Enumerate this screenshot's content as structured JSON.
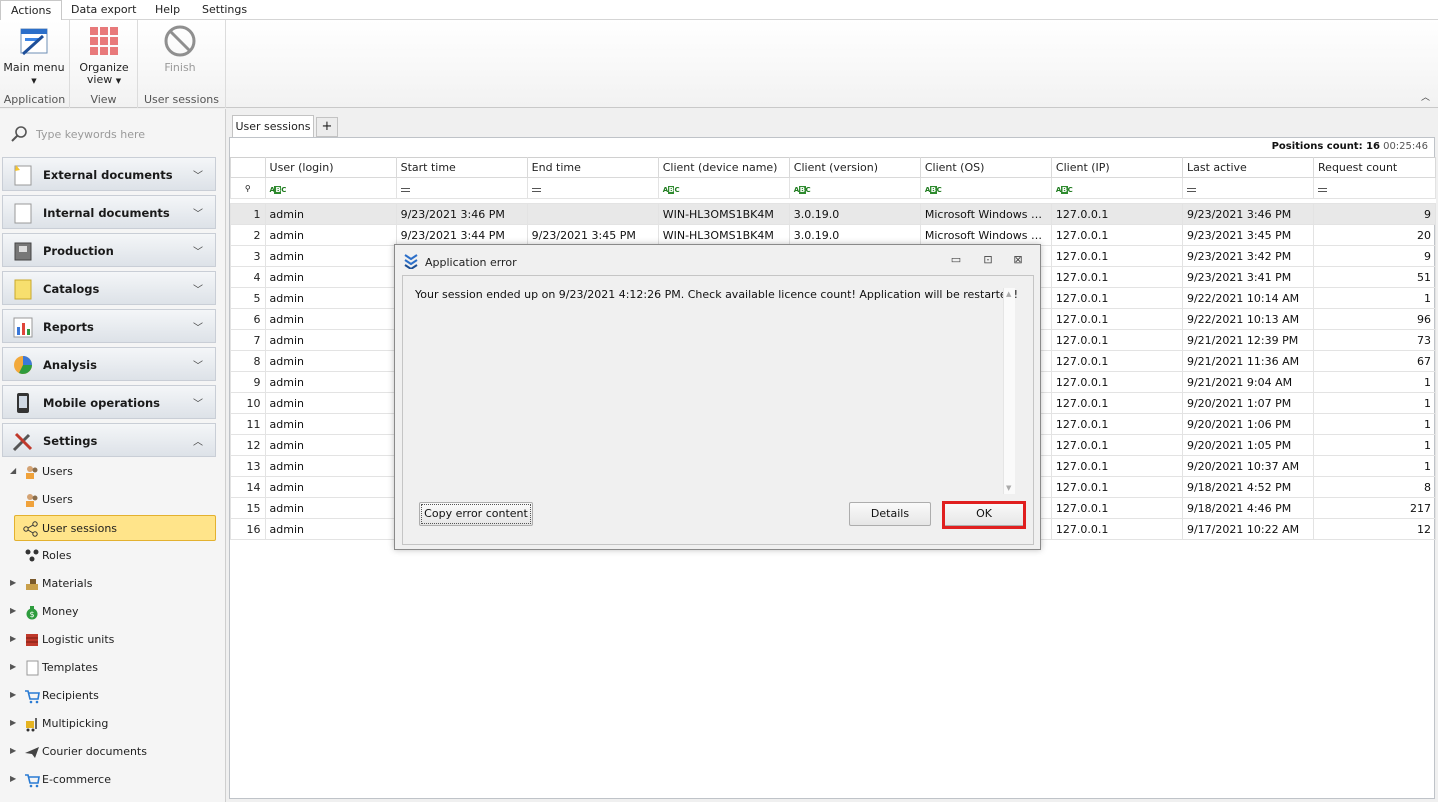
{
  "menu_tabs": [
    "Actions",
    "Data export",
    "Help",
    "Settings"
  ],
  "ribbon": {
    "groups": [
      {
        "label": "Application",
        "buttons": [
          {
            "label_line1": "Main menu",
            "label_line2": "",
            "icon": "main-menu-icon",
            "dropdown": true
          }
        ]
      },
      {
        "label": "View",
        "buttons": [
          {
            "label_line1": "Organize",
            "label_line2": "view",
            "icon": "grid-icon",
            "dropdown": true
          }
        ]
      },
      {
        "label": "User sessions",
        "buttons": [
          {
            "label_line1": "Finish",
            "label_line2": "",
            "icon": "finish-icon",
            "disabled": true
          }
        ]
      }
    ]
  },
  "sidebar": {
    "search_placeholder": "Type keywords here",
    "categories": [
      {
        "label": "External documents",
        "icon": "external-documents-icon",
        "expanded": false
      },
      {
        "label": "Internal documents",
        "icon": "internal-documents-icon",
        "expanded": false
      },
      {
        "label": "Production",
        "icon": "production-icon",
        "expanded": false
      },
      {
        "label": "Catalogs",
        "icon": "catalogs-icon",
        "expanded": false
      },
      {
        "label": "Reports",
        "icon": "reports-icon",
        "expanded": false
      },
      {
        "label": "Analysis",
        "icon": "analysis-icon",
        "expanded": false
      },
      {
        "label": "Mobile operations",
        "icon": "mobile-icon",
        "expanded": false
      },
      {
        "label": "Settings",
        "icon": "settings-icon",
        "expanded": true
      }
    ],
    "tree": [
      {
        "label": "Users",
        "level": 0,
        "arrow": "down"
      },
      {
        "label": "Users",
        "level": 1
      },
      {
        "label": "User sessions",
        "level": 1,
        "selected": true
      },
      {
        "label": "Roles",
        "level": 1
      },
      {
        "label": "Materials",
        "level": 0,
        "arrow": "right"
      },
      {
        "label": "Money",
        "level": 0,
        "arrow": "right"
      },
      {
        "label": "Logistic units",
        "level": 0,
        "arrow": "right"
      },
      {
        "label": "Templates",
        "level": 0,
        "arrow": "right"
      },
      {
        "label": "Recipients",
        "level": 0,
        "arrow": "right"
      },
      {
        "label": "Multipicking",
        "level": 0,
        "arrow": "right"
      },
      {
        "label": "Courier documents",
        "level": 0,
        "arrow": "right"
      },
      {
        "label": "E-commerce",
        "level": 0,
        "arrow": "right"
      }
    ]
  },
  "main": {
    "tab_label": "User sessions",
    "tab_add": "+",
    "positions_label": "Positions count:",
    "positions_value": "16",
    "timer": "00:25:46",
    "columns": [
      "User (login)",
      "Start time",
      "End time",
      "Client (device name)",
      "Client (version)",
      "Client (OS)",
      "Client (IP)",
      "Last active",
      "Request count"
    ],
    "rows": [
      [
        "1",
        "admin",
        "9/23/2021 3:46 PM",
        "",
        "WIN-HL3OMS1BK4M",
        "3.0.19.0",
        "Microsoft Windows NT ...",
        "127.0.0.1",
        "9/23/2021 3:46 PM",
        "9"
      ],
      [
        "2",
        "admin",
        "9/23/2021 3:44 PM",
        "9/23/2021 3:45 PM",
        "WIN-HL3OMS1BK4M",
        "3.0.19.0",
        "Microsoft Windows NT ...",
        "127.0.0.1",
        "9/23/2021 3:45 PM",
        "20"
      ],
      [
        "3",
        "admin",
        "",
        "",
        "",
        "",
        "",
        "127.0.0.1",
        "9/23/2021 3:42 PM",
        "9"
      ],
      [
        "4",
        "admin",
        "",
        "",
        "",
        "",
        "",
        "127.0.0.1",
        "9/23/2021 3:41 PM",
        "51"
      ],
      [
        "5",
        "admin",
        "",
        "",
        "",
        "",
        "",
        "127.0.0.1",
        "9/22/2021 10:14 AM",
        "1"
      ],
      [
        "6",
        "admin",
        "",
        "",
        "",
        "",
        "",
        "127.0.0.1",
        "9/22/2021 10:13 AM",
        "96"
      ],
      [
        "7",
        "admin",
        "",
        "",
        "",
        "",
        "",
        "127.0.0.1",
        "9/21/2021 12:39 PM",
        "73"
      ],
      [
        "8",
        "admin",
        "",
        "",
        "",
        "",
        "",
        "127.0.0.1",
        "9/21/2021 11:36 AM",
        "67"
      ],
      [
        "9",
        "admin",
        "",
        "",
        "",
        "",
        "",
        "127.0.0.1",
        "9/21/2021 9:04 AM",
        "1"
      ],
      [
        "10",
        "admin",
        "",
        "",
        "",
        "",
        "",
        "127.0.0.1",
        "9/20/2021 1:07 PM",
        "1"
      ],
      [
        "11",
        "admin",
        "",
        "",
        "",
        "",
        "",
        "127.0.0.1",
        "9/20/2021 1:06 PM",
        "1"
      ],
      [
        "12",
        "admin",
        "",
        "",
        "",
        "",
        "",
        "127.0.0.1",
        "9/20/2021 1:05 PM",
        "1"
      ],
      [
        "13",
        "admin",
        "",
        "",
        "",
        "",
        "",
        "127.0.0.1",
        "9/20/2021 10:37 AM",
        "1"
      ],
      [
        "14",
        "admin",
        "",
        "",
        "",
        "",
        "",
        "127.0.0.1",
        "9/18/2021 4:52 PM",
        "8"
      ],
      [
        "15",
        "admin",
        "",
        "",
        "",
        "",
        "",
        "127.0.0.1",
        "9/18/2021 4:46 PM",
        "217"
      ],
      [
        "16",
        "admin",
        "",
        "",
        "",
        "",
        "",
        "127.0.0.1",
        "9/17/2021 10:22 AM",
        "12"
      ]
    ],
    "filter_types": [
      "abc",
      "eq",
      "eq",
      "abc",
      "abc",
      "abc",
      "abc",
      "eq",
      "eq"
    ]
  },
  "dialog": {
    "title": "Application error",
    "message": "Your session ended up on 9/23/2021 4:12:26 PM. Check available licence count! Application will be restarted!",
    "copy_button": "Copy error content",
    "details_button": "Details",
    "ok_button": "OK",
    "highlight_color": "#e01f1f"
  }
}
